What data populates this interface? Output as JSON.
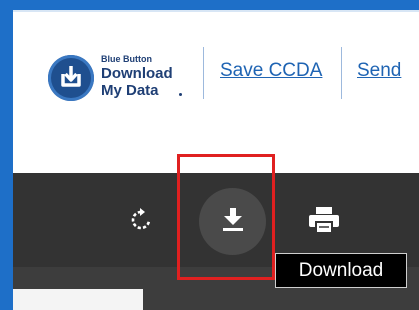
{
  "header": {
    "logo": {
      "small_text": "Blue Button",
      "line1": "Download",
      "line2": "My Data"
    },
    "links": [
      {
        "label": "Save CCDA"
      },
      {
        "label": "Send"
      }
    ]
  },
  "toolbar": {
    "buttons": [
      {
        "icon": "rotate-icon"
      },
      {
        "icon": "download-icon",
        "state": "hovered"
      },
      {
        "icon": "print-icon"
      }
    ],
    "tooltip": "Download"
  },
  "colors": {
    "frame": "#1e6fc8",
    "link": "#1f64b3",
    "toolbar": "#333333",
    "highlight": "#e02020"
  }
}
